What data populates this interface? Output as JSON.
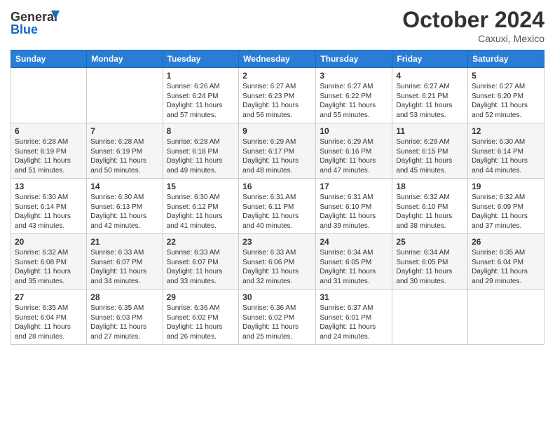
{
  "header": {
    "logo_general": "General",
    "logo_blue": "Blue",
    "month_title": "October 2024",
    "location": "Caxuxi, Mexico"
  },
  "weekdays": [
    "Sunday",
    "Monday",
    "Tuesday",
    "Wednesday",
    "Thursday",
    "Friday",
    "Saturday"
  ],
  "weeks": [
    [
      {
        "day": "",
        "sunrise": "",
        "sunset": "",
        "daylight": ""
      },
      {
        "day": "",
        "sunrise": "",
        "sunset": "",
        "daylight": ""
      },
      {
        "day": "1",
        "sunrise": "Sunrise: 6:26 AM",
        "sunset": "Sunset: 6:24 PM",
        "daylight": "Daylight: 11 hours and 57 minutes."
      },
      {
        "day": "2",
        "sunrise": "Sunrise: 6:27 AM",
        "sunset": "Sunset: 6:23 PM",
        "daylight": "Daylight: 11 hours and 56 minutes."
      },
      {
        "day": "3",
        "sunrise": "Sunrise: 6:27 AM",
        "sunset": "Sunset: 6:22 PM",
        "daylight": "Daylight: 11 hours and 55 minutes."
      },
      {
        "day": "4",
        "sunrise": "Sunrise: 6:27 AM",
        "sunset": "Sunset: 6:21 PM",
        "daylight": "Daylight: 11 hours and 53 minutes."
      },
      {
        "day": "5",
        "sunrise": "Sunrise: 6:27 AM",
        "sunset": "Sunset: 6:20 PM",
        "daylight": "Daylight: 11 hours and 52 minutes."
      }
    ],
    [
      {
        "day": "6",
        "sunrise": "Sunrise: 6:28 AM",
        "sunset": "Sunset: 6:19 PM",
        "daylight": "Daylight: 11 hours and 51 minutes."
      },
      {
        "day": "7",
        "sunrise": "Sunrise: 6:28 AM",
        "sunset": "Sunset: 6:19 PM",
        "daylight": "Daylight: 11 hours and 50 minutes."
      },
      {
        "day": "8",
        "sunrise": "Sunrise: 6:28 AM",
        "sunset": "Sunset: 6:18 PM",
        "daylight": "Daylight: 11 hours and 49 minutes."
      },
      {
        "day": "9",
        "sunrise": "Sunrise: 6:29 AM",
        "sunset": "Sunset: 6:17 PM",
        "daylight": "Daylight: 11 hours and 48 minutes."
      },
      {
        "day": "10",
        "sunrise": "Sunrise: 6:29 AM",
        "sunset": "Sunset: 6:16 PM",
        "daylight": "Daylight: 11 hours and 47 minutes."
      },
      {
        "day": "11",
        "sunrise": "Sunrise: 6:29 AM",
        "sunset": "Sunset: 6:15 PM",
        "daylight": "Daylight: 11 hours and 45 minutes."
      },
      {
        "day": "12",
        "sunrise": "Sunrise: 6:30 AM",
        "sunset": "Sunset: 6:14 PM",
        "daylight": "Daylight: 11 hours and 44 minutes."
      }
    ],
    [
      {
        "day": "13",
        "sunrise": "Sunrise: 6:30 AM",
        "sunset": "Sunset: 6:14 PM",
        "daylight": "Daylight: 11 hours and 43 minutes."
      },
      {
        "day": "14",
        "sunrise": "Sunrise: 6:30 AM",
        "sunset": "Sunset: 6:13 PM",
        "daylight": "Daylight: 11 hours and 42 minutes."
      },
      {
        "day": "15",
        "sunrise": "Sunrise: 6:30 AM",
        "sunset": "Sunset: 6:12 PM",
        "daylight": "Daylight: 11 hours and 41 minutes."
      },
      {
        "day": "16",
        "sunrise": "Sunrise: 6:31 AM",
        "sunset": "Sunset: 6:11 PM",
        "daylight": "Daylight: 11 hours and 40 minutes."
      },
      {
        "day": "17",
        "sunrise": "Sunrise: 6:31 AM",
        "sunset": "Sunset: 6:10 PM",
        "daylight": "Daylight: 11 hours and 39 minutes."
      },
      {
        "day": "18",
        "sunrise": "Sunrise: 6:32 AM",
        "sunset": "Sunset: 6:10 PM",
        "daylight": "Daylight: 11 hours and 38 minutes."
      },
      {
        "day": "19",
        "sunrise": "Sunrise: 6:32 AM",
        "sunset": "Sunset: 6:09 PM",
        "daylight": "Daylight: 11 hours and 37 minutes."
      }
    ],
    [
      {
        "day": "20",
        "sunrise": "Sunrise: 6:32 AM",
        "sunset": "Sunset: 6:08 PM",
        "daylight": "Daylight: 11 hours and 35 minutes."
      },
      {
        "day": "21",
        "sunrise": "Sunrise: 6:33 AM",
        "sunset": "Sunset: 6:07 PM",
        "daylight": "Daylight: 11 hours and 34 minutes."
      },
      {
        "day": "22",
        "sunrise": "Sunrise: 6:33 AM",
        "sunset": "Sunset: 6:07 PM",
        "daylight": "Daylight: 11 hours and 33 minutes."
      },
      {
        "day": "23",
        "sunrise": "Sunrise: 6:33 AM",
        "sunset": "Sunset: 6:06 PM",
        "daylight": "Daylight: 11 hours and 32 minutes."
      },
      {
        "day": "24",
        "sunrise": "Sunrise: 6:34 AM",
        "sunset": "Sunset: 6:05 PM",
        "daylight": "Daylight: 11 hours and 31 minutes."
      },
      {
        "day": "25",
        "sunrise": "Sunrise: 6:34 AM",
        "sunset": "Sunset: 6:05 PM",
        "daylight": "Daylight: 11 hours and 30 minutes."
      },
      {
        "day": "26",
        "sunrise": "Sunrise: 6:35 AM",
        "sunset": "Sunset: 6:04 PM",
        "daylight": "Daylight: 11 hours and 29 minutes."
      }
    ],
    [
      {
        "day": "27",
        "sunrise": "Sunrise: 6:35 AM",
        "sunset": "Sunset: 6:04 PM",
        "daylight": "Daylight: 11 hours and 28 minutes."
      },
      {
        "day": "28",
        "sunrise": "Sunrise: 6:35 AM",
        "sunset": "Sunset: 6:03 PM",
        "daylight": "Daylight: 11 hours and 27 minutes."
      },
      {
        "day": "29",
        "sunrise": "Sunrise: 6:36 AM",
        "sunset": "Sunset: 6:02 PM",
        "daylight": "Daylight: 11 hours and 26 minutes."
      },
      {
        "day": "30",
        "sunrise": "Sunrise: 6:36 AM",
        "sunset": "Sunset: 6:02 PM",
        "daylight": "Daylight: 11 hours and 25 minutes."
      },
      {
        "day": "31",
        "sunrise": "Sunrise: 6:37 AM",
        "sunset": "Sunset: 6:01 PM",
        "daylight": "Daylight: 11 hours and 24 minutes."
      },
      {
        "day": "",
        "sunrise": "",
        "sunset": "",
        "daylight": ""
      },
      {
        "day": "",
        "sunrise": "",
        "sunset": "",
        "daylight": ""
      }
    ]
  ]
}
